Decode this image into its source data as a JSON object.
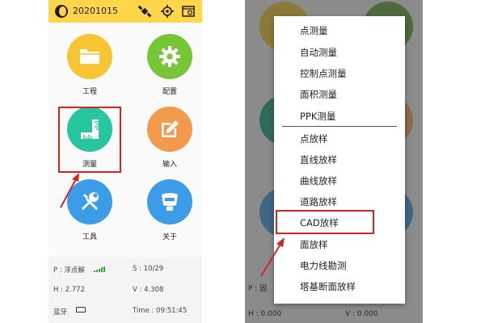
{
  "left": {
    "project_name": "20201015",
    "apps": [
      {
        "label": "工程",
        "color": "#f7c433",
        "icon": "folder-icon"
      },
      {
        "label": "配置",
        "color": "#79c53a",
        "icon": "gear-icon"
      },
      {
        "label": "测量",
        "color": "#27c5a0",
        "icon": "ruler-icon"
      },
      {
        "label": "输入",
        "color": "#f29a4b",
        "icon": "edit-icon"
      },
      {
        "label": "工具",
        "color": "#3d9ce7",
        "icon": "tools-icon"
      },
      {
        "label": "关于",
        "color": "#3d9ce7",
        "icon": "receiver-icon"
      }
    ],
    "status": {
      "p": "P : 浮点解",
      "s": "S : 10/29",
      "h": "H : 2.772",
      "v": "V : 4.308",
      "bt": "蓝牙",
      "time": "Time : 09:51:45"
    }
  },
  "right": {
    "menu_items": [
      "点测量",
      "自动测量",
      "控制点测量",
      "面积测量",
      "PPK测量",
      "点放样",
      "直线放样",
      "曲线放样",
      "道路放样",
      "CAD放样",
      "面放样",
      "电力线勘测",
      "塔基断面放样"
    ],
    "behind": {
      "p": "P : 固",
      "h": "H : 0.000",
      "v": "V : 0.000"
    }
  },
  "colors": {
    "topbar": "#ffd54a",
    "highlight": "#d32424"
  }
}
